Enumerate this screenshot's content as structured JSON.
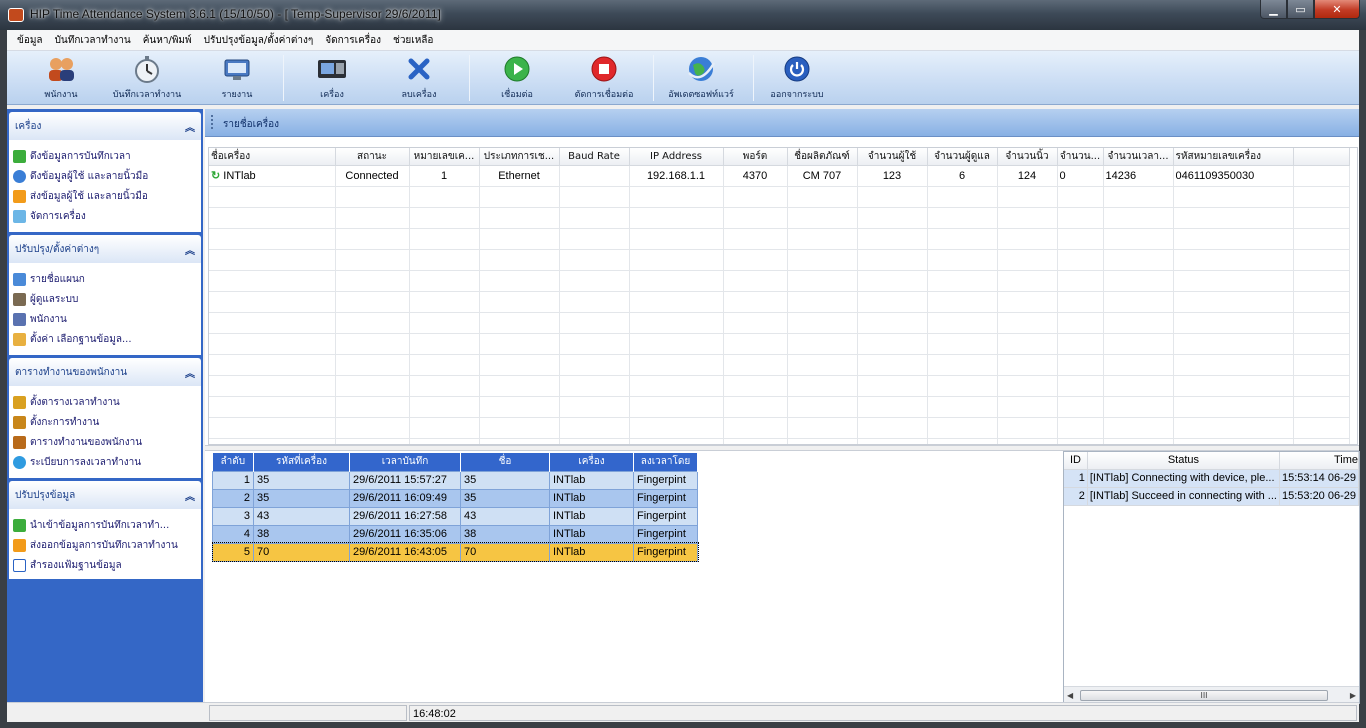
{
  "window": {
    "title": "HIP Time Attendance System 3.6.1 (15/10/50) - [ Temp-Supervisor 29/6/2011]"
  },
  "menu": [
    "ข้อมูล",
    "บันทึกเวลาทำงาน",
    "ค้นหา/พิมพ์",
    "ปรับปรุงข้อมูล/ตั้งค่าต่างๆ",
    "จัดการเครื่อง",
    "ช่วยเหลือ"
  ],
  "toolbar": {
    "employee": "พนักงาน",
    "record_time": "บันทึกเวลาทำงาน",
    "report": "รายงาน",
    "device": "เครื่อง",
    "delete_device": "ลบเครื่อง",
    "connect": "เชื่อมต่อ",
    "disconnect": "ตัดการเชื่อมต่อ",
    "update_software": "อัพเดตซอฟท์แวร์",
    "logout": "ออกจากระบบ"
  },
  "sidebar": {
    "groups": [
      {
        "title": "เครื่อง",
        "items": [
          "ดึงข้อมูลการบันทึกเวลา",
          "ดึงข้อมูลผู้ใช้ และลายนิ้วมือ",
          "ส่งข้อมูลผู้ใช้ และลายนิ้วมือ",
          "จัดการเครื่อง"
        ]
      },
      {
        "title": "ปรับปรุง/ตั้งค่าต่างๆ",
        "items": [
          "รายชื่อแผนก",
          "ผู้ดูแลระบบ",
          "พนักงาน",
          "ตั้งค่า เลือกฐานข้อมูล..."
        ]
      },
      {
        "title": "ตารางทำงานของพนักงาน",
        "items": [
          "ตั้งตารางเวลาทำงาน",
          "ตั้งกะการทำงาน",
          "ตารางทำงานของพนักงาน",
          "ระเบียบการลงเวลาทำงาน"
        ]
      },
      {
        "title": "ปรับปรุงข้อมูล",
        "items": [
          "นำเข้าข้อมูลการบันทึกเวลาทำ...",
          "ส่งออกข้อมูลการบันทึกเวลาทำงาน",
          "สำรองแฟ้มฐานข้อมูล"
        ]
      }
    ]
  },
  "panel": {
    "title": "รายชื่อเครื่อง"
  },
  "devices": {
    "columns": [
      "ชื่อเครื่อง",
      "สถานะ",
      "หมายเลขเค...",
      "ประเภทการเช...",
      "Baud Rate",
      "IP Address",
      "พอร์ต",
      "ชื่อผลิตภัณฑ์",
      "จำนวนผู้ใช้",
      "จำนวนผู้ดูแล",
      "จำนวนนิ้ว",
      "จำนวน...",
      "จำนวนเวลา...",
      "รหัสหมายเลขเครื่อง"
    ],
    "rows": [
      [
        "INTlab",
        "Connected",
        "1",
        "Ethernet",
        "",
        "192.168.1.1",
        "4370",
        "CM 707",
        "123",
        "6",
        "124",
        "0",
        "14236",
        "0461109350030"
      ]
    ]
  },
  "attendance": {
    "columns": [
      "ลำดับ",
      "รหัสที่เครื่อง",
      "เวลาบันทึก",
      "ชื่อ",
      "เครื่อง",
      "ลงเวลาโดย"
    ],
    "rows": [
      [
        "1",
        "35",
        "29/6/2011 15:57:27",
        "35",
        "INTlab",
        "Fingerpint"
      ],
      [
        "2",
        "35",
        "29/6/2011 16:09:49",
        "35",
        "INTlab",
        "Fingerpint"
      ],
      [
        "3",
        "43",
        "29/6/2011 16:27:58",
        "43",
        "INTlab",
        "Fingerpint"
      ],
      [
        "4",
        "38",
        "29/6/2011 16:35:06",
        "38",
        "INTlab",
        "Fingerpint"
      ],
      [
        "5",
        "70",
        "29/6/2011 16:43:05",
        "70",
        "INTlab",
        "Fingerpint"
      ]
    ]
  },
  "log": {
    "columns": [
      "ID",
      "Status",
      "Time"
    ],
    "rows": [
      [
        "1",
        "[INTlab] Connecting with device, ple...",
        "15:53:14 06-29"
      ],
      [
        "2",
        "[INTlab] Succeed in connecting with ...",
        "15:53:20 06-29"
      ]
    ],
    "scroll_grip": "III"
  },
  "status": {
    "clock": "16:48:02"
  }
}
